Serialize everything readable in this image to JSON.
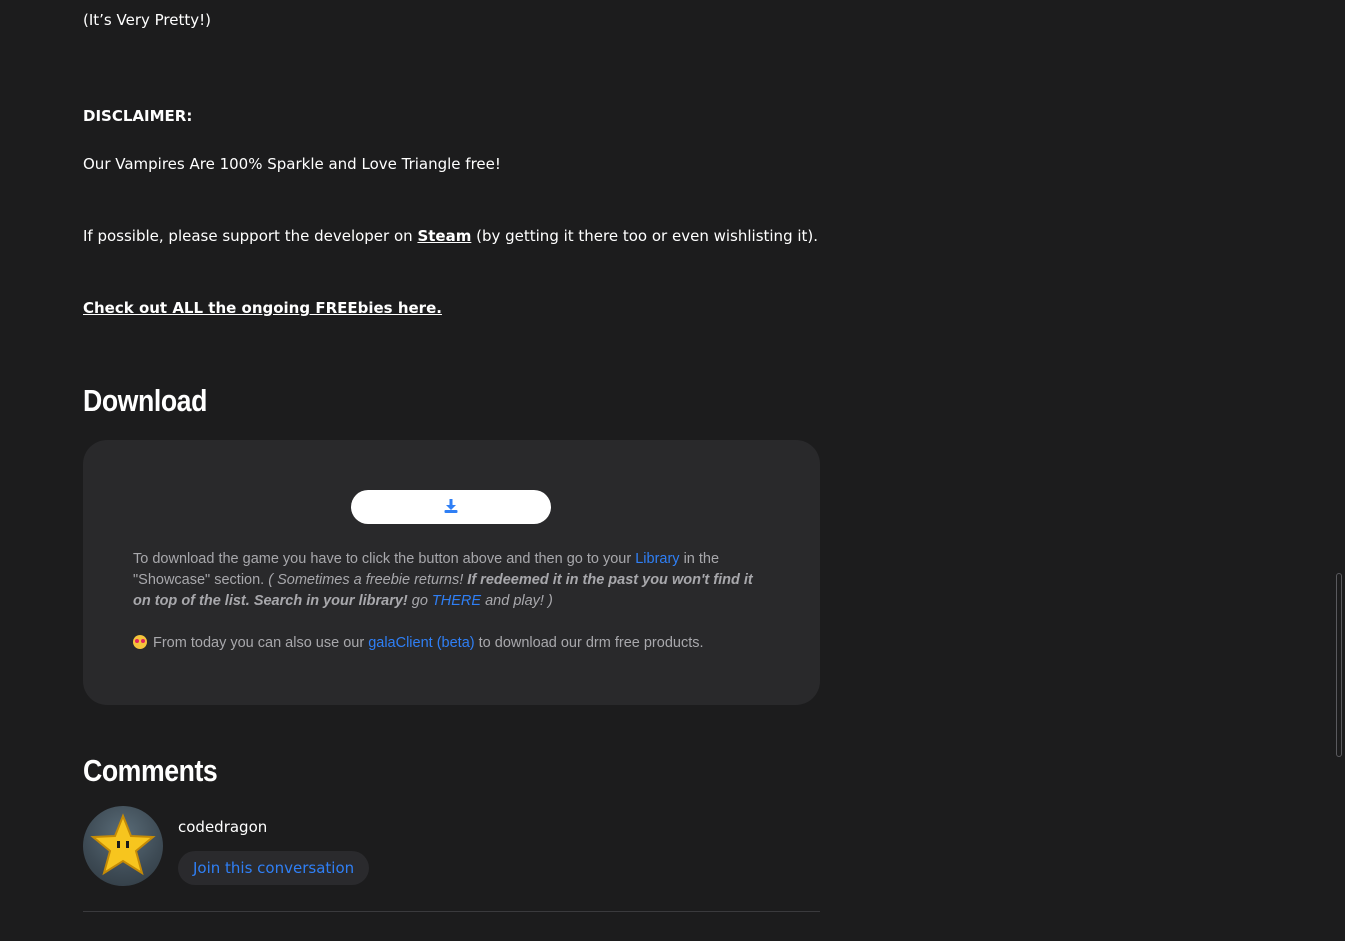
{
  "description": {
    "pretty_line": "(It’s Very Pretty!)",
    "disclaimer_heading": "DISCLAIMER:",
    "disclaimer_text": "Our Vampires Are 100% Sparkle and Love Triangle free!",
    "support_prefix": "If possible, please support the developer on ",
    "support_link": "Steam",
    "support_suffix": " (by getting it there too or even wishlisting it).",
    "freebies_link": "Check out ALL the ongoing FREEbies here."
  },
  "download": {
    "title": "Download",
    "button_icon": "download-icon",
    "info_1_prefix": "To download the game you have to click the button above and then go to your ",
    "info_1_library": "Library",
    "info_1_mid": " in the",
    "info_2_prefix": "\"Showcase\" section. ",
    "info_2_italic": "( Sometimes a freebie returns! ",
    "info_2_bold_italic": "If redeemed it in the past you won't find it",
    "info_3_bold_italic": "on top of the list. Search in your library!",
    "info_3_go": " go ",
    "info_3_there": "THERE",
    "info_3_end": " and play! )",
    "client_prefix": "From today you can also use our ",
    "client_link": "galaClient (beta)",
    "client_suffix": " to download our drm free products.",
    "client_emoji": "star-struck-emoji"
  },
  "comments": {
    "title": "Comments",
    "username": "codedragon",
    "join_label": "Join this conversation",
    "avatar_icon": "star-icon"
  },
  "colors": {
    "background": "#1c1c1d",
    "panel": "#29292b",
    "accent_blue": "#2f7ff5",
    "muted_text": "#a8a8ac"
  }
}
